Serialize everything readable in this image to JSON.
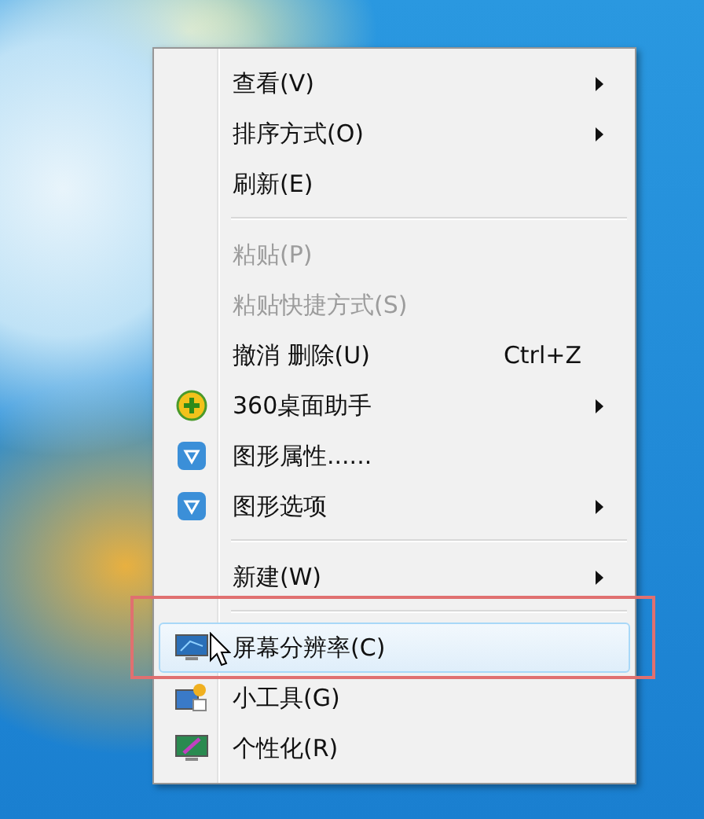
{
  "context_menu": {
    "items": [
      {
        "kind": "item",
        "label": "查看(V)",
        "submenu": true,
        "disabled": false,
        "selected": false
      },
      {
        "kind": "item",
        "label": "排序方式(O)",
        "submenu": true,
        "disabled": false,
        "selected": false
      },
      {
        "kind": "item",
        "label": "刷新(E)",
        "submenu": false,
        "disabled": false,
        "selected": false
      },
      {
        "kind": "separator"
      },
      {
        "kind": "item",
        "label": "粘贴(P)",
        "submenu": false,
        "disabled": true,
        "selected": false
      },
      {
        "kind": "item",
        "label": "粘贴快捷方式(S)",
        "submenu": false,
        "disabled": true,
        "selected": false
      },
      {
        "kind": "item",
        "label": "撤消 删除(U)",
        "shortcut": "Ctrl+Z",
        "submenu": false,
        "disabled": false,
        "selected": false
      },
      {
        "kind": "item",
        "label": "360桌面助手",
        "submenu": true,
        "disabled": false,
        "selected": false
      },
      {
        "kind": "item",
        "label": "图形属性......",
        "submenu": false,
        "disabled": false,
        "selected": false
      },
      {
        "kind": "item",
        "label": "图形选项",
        "submenu": true,
        "disabled": false,
        "selected": false
      },
      {
        "kind": "separator"
      },
      {
        "kind": "item",
        "label": "新建(W)",
        "submenu": true,
        "disabled": false,
        "selected": false
      },
      {
        "kind": "separator"
      },
      {
        "kind": "item",
        "label": "屏幕分辨率(C)",
        "submenu": false,
        "disabled": false,
        "selected": true
      },
      {
        "kind": "item",
        "label": "小工具(G)",
        "submenu": false,
        "disabled": false,
        "selected": false
      },
      {
        "kind": "item",
        "label": "个性化(R)",
        "submenu": false,
        "disabled": false,
        "selected": false
      }
    ]
  }
}
